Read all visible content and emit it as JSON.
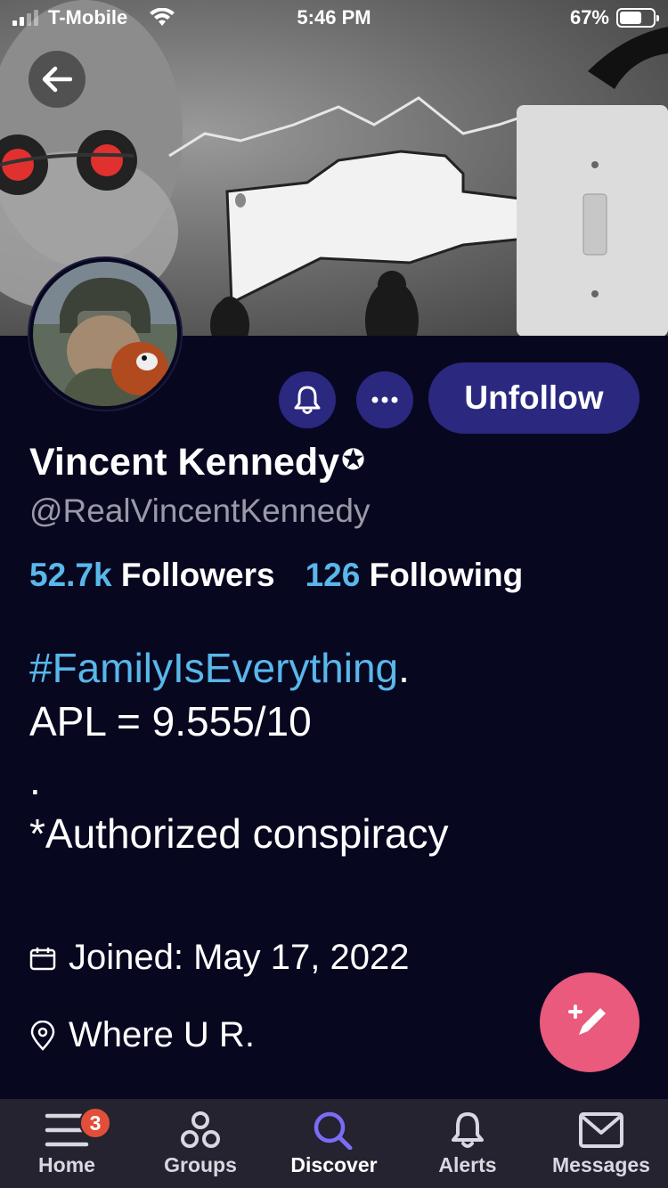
{
  "status_bar": {
    "carrier": "T-Mobile",
    "time": "5:46 PM",
    "battery_percent": "67%",
    "battery_level": 0.67
  },
  "profile": {
    "name": "Vincent Kennedy",
    "verified_glyph": "✪",
    "handle": "@RealVincentKennedy",
    "followers_count": "52.7k",
    "followers_label": "Followers",
    "following_count": "126",
    "following_label": "Following",
    "bio": {
      "hashtag": "#FamilyIsEverything",
      "hashtag_suffix": ".",
      "line2": "APL = 9.555/10",
      "line3": ".",
      "line4": "*Authorized conspiracy"
    },
    "joined": "Joined: May 17, 2022",
    "location": "Where U R."
  },
  "actions": {
    "unfollow_label": "Unfollow",
    "bell_icon": "bell-icon",
    "more_icon": "more-icon",
    "compose_icon": "compose-icon"
  },
  "tabbar": {
    "items": [
      {
        "label": "Home",
        "icon": "home-icon",
        "badge": "3"
      },
      {
        "label": "Groups",
        "icon": "groups-icon"
      },
      {
        "label": "Discover",
        "icon": "search-icon",
        "active": true
      },
      {
        "label": "Alerts",
        "icon": "bell-icon"
      },
      {
        "label": "Messages",
        "icon": "mail-icon"
      }
    ]
  },
  "colors": {
    "background": "#080720",
    "accent_button": "#2b2880",
    "link_blue": "#59b7ea",
    "fab_pink": "#e95a7c",
    "active_tab_purple": "#7b6cf6",
    "badge_red": "#e14f3b",
    "tabbar_bg": "#24232f"
  }
}
